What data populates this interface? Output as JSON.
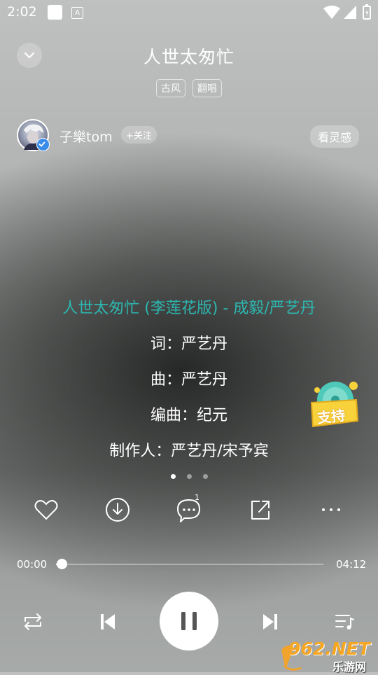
{
  "status": {
    "time": "2:02",
    "notif_icon_text": "A"
  },
  "header": {
    "title": "人世太匆忙",
    "tags": [
      "古风",
      "翻唱"
    ]
  },
  "artist": {
    "name": "子樂tom",
    "follow_label": "+关注",
    "vibe_label": "看灵感"
  },
  "lyrics": {
    "lines": [
      "人世太匆忙 (李莲花版) - 成毅/严艺丹",
      "词：严艺丹",
      "曲：严艺丹",
      "编曲：纪元",
      "制作人：严艺丹/宋予宾"
    ],
    "active_index": 0,
    "page_count": 3,
    "page_index": 0
  },
  "support_badge": {
    "label": "支持"
  },
  "actions": {
    "comment_count": "1",
    "icons": [
      "heart-icon",
      "download-icon",
      "comment-icon",
      "share-icon",
      "more-icon"
    ]
  },
  "progress": {
    "current": "00:00",
    "total": "04:12",
    "fraction": 0.02
  },
  "controls": {
    "icons": [
      "repeat-icon",
      "previous-icon",
      "pause-icon",
      "next-icon",
      "playlist-icon"
    ],
    "state": "playing"
  },
  "watermark": {
    "text": "962.NET",
    "sub": "乐游网"
  },
  "colors": {
    "lyric_active": "#2cb7b0",
    "verified_badge": "#3a8ce9",
    "support_yellow": "#f7d23a",
    "support_teal": "#4fc9b9"
  }
}
